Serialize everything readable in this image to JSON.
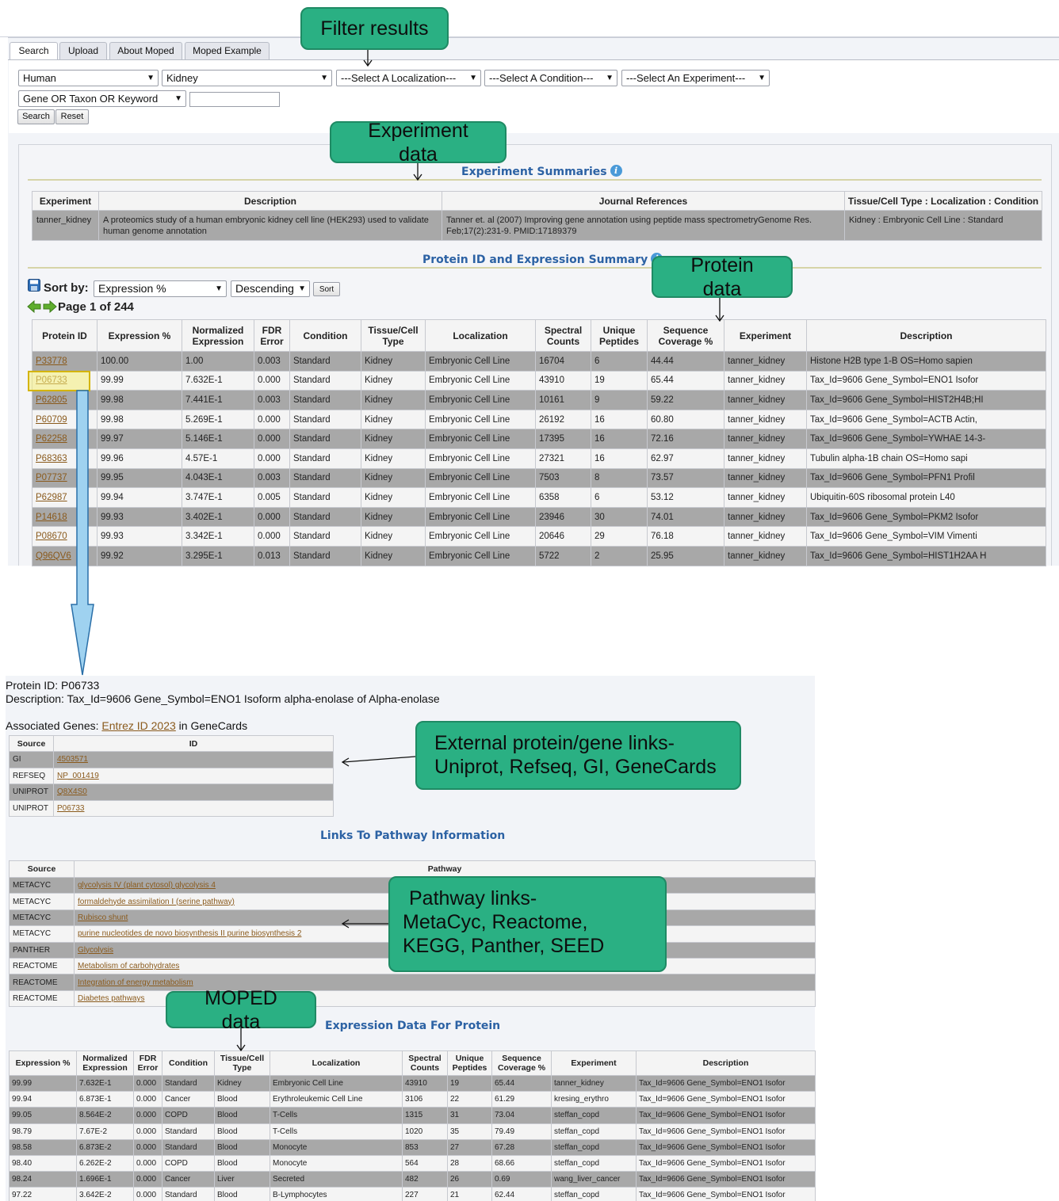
{
  "tabs": [
    "Search",
    "Upload",
    "About Moped",
    "Moped Example"
  ],
  "filters": {
    "organism": "Human",
    "tissue": "Kidney",
    "localization": "---Select A Localization---",
    "condition": "---Select A Condition---",
    "experiment": "---Select An Experiment---",
    "search_type": "Gene OR Taxon OR Keyword",
    "search_value": "",
    "search_button": "Search",
    "reset_button": "Reset"
  },
  "experiment_summaries": {
    "title": "Experiment Summaries",
    "headers": [
      "Experiment",
      "Description",
      "Journal References",
      "Tissue/Cell Type : Localization : Condition"
    ],
    "row": [
      "tanner_kidney",
      "A proteomics study of a human embryonic kidney cell line (HEK293) used to validate human genome annotation",
      "Tanner et. al (2007) Improving gene annotation using peptide mass spectrometryGenome Res. Feb;17(2):231-9. PMID:17189379",
      "Kidney : Embryonic Cell Line : Standard"
    ]
  },
  "protein_summary": {
    "title": "Protein ID and Expression Summary",
    "sort_label": "Sort by:",
    "sort_field": "Expression %",
    "sort_order": "Descending",
    "sort_button": "Sort",
    "page_label": "Page 1 of 244",
    "headers": [
      "Protein ID",
      "Expression %",
      "Normalized Expression",
      "FDR Error",
      "Condition",
      "Tissue/Cell Type",
      "Localization",
      "Spectral Counts",
      "Unique Peptides",
      "Sequence Coverage %",
      "Experiment",
      "Description"
    ],
    "rows": [
      [
        "P33778",
        "100.00",
        "1.00",
        "0.003",
        "Standard",
        "Kidney",
        "Embryonic Cell Line",
        "16704",
        "6",
        "44.44",
        "tanner_kidney",
        "Histone H2B type 1-B OS=Homo sapien"
      ],
      [
        "P06733",
        "99.99",
        "7.632E-1",
        "0.000",
        "Standard",
        "Kidney",
        "Embryonic Cell Line",
        "43910",
        "19",
        "65.44",
        "tanner_kidney",
        "Tax_Id=9606 Gene_Symbol=ENO1 Isofor"
      ],
      [
        "P62805",
        "99.98",
        "7.441E-1",
        "0.003",
        "Standard",
        "Kidney",
        "Embryonic Cell Line",
        "10161",
        "9",
        "59.22",
        "tanner_kidney",
        "Tax_Id=9606 Gene_Symbol=HIST2H4B;HI"
      ],
      [
        "P60709",
        "99.98",
        "5.269E-1",
        "0.000",
        "Standard",
        "Kidney",
        "Embryonic Cell Line",
        "26192",
        "16",
        "60.80",
        "tanner_kidney",
        "Tax_Id=9606 Gene_Symbol=ACTB Actin,"
      ],
      [
        "P62258",
        "99.97",
        "5.146E-1",
        "0.000",
        "Standard",
        "Kidney",
        "Embryonic Cell Line",
        "17395",
        "16",
        "72.16",
        "tanner_kidney",
        "Tax_Id=9606 Gene_Symbol=YWHAE 14-3-"
      ],
      [
        "P68363",
        "99.96",
        "4.57E-1",
        "0.000",
        "Standard",
        "Kidney",
        "Embryonic Cell Line",
        "27321",
        "16",
        "62.97",
        "tanner_kidney",
        "Tubulin alpha-1B chain OS=Homo sapi"
      ],
      [
        "P07737",
        "99.95",
        "4.043E-1",
        "0.003",
        "Standard",
        "Kidney",
        "Embryonic Cell Line",
        "7503",
        "8",
        "73.57",
        "tanner_kidney",
        "Tax_Id=9606 Gene_Symbol=PFN1 Profil"
      ],
      [
        "P62987",
        "99.94",
        "3.747E-1",
        "0.005",
        "Standard",
        "Kidney",
        "Embryonic Cell Line",
        "6358",
        "6",
        "53.12",
        "tanner_kidney",
        "Ubiquitin-60S ribosomal protein L40"
      ],
      [
        "P14618",
        "99.93",
        "3.402E-1",
        "0.000",
        "Standard",
        "Kidney",
        "Embryonic Cell Line",
        "23946",
        "30",
        "74.01",
        "tanner_kidney",
        "Tax_Id=9606 Gene_Symbol=PKM2 Isofor"
      ],
      [
        "P08670",
        "99.93",
        "3.342E-1",
        "0.000",
        "Standard",
        "Kidney",
        "Embryonic Cell Line",
        "20646",
        "29",
        "76.18",
        "tanner_kidney",
        "Tax_Id=9606 Gene_Symbol=VIM Vimenti"
      ],
      [
        "Q96QV6",
        "99.92",
        "3.295E-1",
        "0.013",
        "Standard",
        "Kidney",
        "Embryonic Cell Line",
        "5722",
        "2",
        "25.95",
        "tanner_kidney",
        "Tax_Id=9606 Gene_Symbol=HIST1H2AA H"
      ]
    ]
  },
  "protein_detail": {
    "protein_id_line": "Protein ID: P06733",
    "description_line": "Description: Tax_Id=9606 Gene_Symbol=ENO1 Isoform alpha-enolase of Alpha-enolase",
    "assoc_prefix": "Associated Genes: ",
    "assoc_link": "Entrez ID 2023",
    "assoc_suffix": " in GeneCards",
    "external_headers": [
      "Source",
      "ID"
    ],
    "external_rows": [
      [
        "GI",
        "4503571"
      ],
      [
        "REFSEQ",
        "NP_001419"
      ],
      [
        "UNIPROT",
        "Q8X4S0"
      ],
      [
        "UNIPROT",
        "P06733"
      ]
    ],
    "pathway_title": "Links To Pathway Information",
    "pathway_headers": [
      "Source",
      "Pathway"
    ],
    "pathway_rows": [
      [
        "METACYC",
        "glycolysis IV (plant cytosol) glycolysis 4"
      ],
      [
        "METACYC",
        "formaldehyde assimilation I (serine pathway)"
      ],
      [
        "METACYC",
        "Rubisco shunt"
      ],
      [
        "METACYC",
        "purine nucleotides de novo biosynthesis II purine biosynthesis 2"
      ],
      [
        "PANTHER",
        "Glycolysis"
      ],
      [
        "REACTOME",
        "Metabolism of carbohydrates"
      ],
      [
        "REACTOME",
        "Integration of energy metabolism"
      ],
      [
        "REACTOME",
        "Diabetes pathways"
      ]
    ],
    "expression_title": "Expression Data For Protein",
    "expression_headers": [
      "Expression %",
      "Normalized Expression",
      "FDR Error",
      "Condition",
      "Tissue/Cell Type",
      "Localization",
      "Spectral Counts",
      "Unique Peptides",
      "Sequence Coverage %",
      "Experiment",
      "Description"
    ],
    "expression_rows": [
      [
        "99.99",
        "7.632E-1",
        "0.000",
        "Standard",
        "Kidney",
        "Embryonic Cell Line",
        "43910",
        "19",
        "65.44",
        "tanner_kidney",
        "Tax_Id=9606 Gene_Symbol=ENO1 Isofor"
      ],
      [
        "99.94",
        "6.873E-1",
        "0.000",
        "Cancer",
        "Blood",
        "Erythroleukemic Cell Line",
        "3106",
        "22",
        "61.29",
        "kresing_erythro",
        "Tax_Id=9606 Gene_Symbol=ENO1 Isofor"
      ],
      [
        "99.05",
        "8.564E-2",
        "0.000",
        "COPD",
        "Blood",
        "T-Cells",
        "1315",
        "31",
        "73.04",
        "steffan_copd",
        "Tax_Id=9606 Gene_Symbol=ENO1 Isofor"
      ],
      [
        "98.79",
        "7.67E-2",
        "0.000",
        "Standard",
        "Blood",
        "T-Cells",
        "1020",
        "35",
        "79.49",
        "steffan_copd",
        "Tax_Id=9606 Gene_Symbol=ENO1 Isofor"
      ],
      [
        "98.58",
        "6.873E-2",
        "0.000",
        "Standard",
        "Blood",
        "Monocyte",
        "853",
        "27",
        "67.28",
        "steffan_copd",
        "Tax_Id=9606 Gene_Symbol=ENO1 Isofor"
      ],
      [
        "98.40",
        "6.262E-2",
        "0.000",
        "COPD",
        "Blood",
        "Monocyte",
        "564",
        "28",
        "68.66",
        "steffan_copd",
        "Tax_Id=9606 Gene_Symbol=ENO1 Isofor"
      ],
      [
        "98.24",
        "1.696E-1",
        "0.000",
        "Cancer",
        "Liver",
        "Secreted",
        "482",
        "26",
        "0.69",
        "wang_liver_cancer",
        "Tax_Id=9606 Gene_Symbol=ENO1 Isofor"
      ],
      [
        "97.22",
        "3.642E-2",
        "0.000",
        "Standard",
        "Blood",
        "B-Lymphocytes",
        "227",
        "21",
        "62.44",
        "steffan_copd",
        "Tax_Id=9606 Gene_Symbol=ENO1 Isofor"
      ]
    ]
  },
  "callouts": {
    "filter": "Filter results",
    "experiment": "Experiment data",
    "protein": "Protein data",
    "external_line1": "External protein/gene links-",
    "external_line2": "Uniprot, Refseq, GI, GeneCards",
    "pathway_line1": "Pathway links-",
    "pathway_line2": "MetaCyc, Reactome,",
    "pathway_line3": "KEGG, Panther, SEED",
    "moped": "MOPED data"
  },
  "colors": {
    "callout_fill": "#2ab083",
    "section_title": "#2c62a4",
    "link": "#8a5a1c",
    "row_dark": "#a8a8a8",
    "row_light": "#f4f4f4",
    "highlight": "#f5ef7a"
  },
  "icons": [
    "save-icon",
    "info-icon",
    "prev-page-icon",
    "next-page-icon",
    "dropdown-arrow-icon"
  ]
}
